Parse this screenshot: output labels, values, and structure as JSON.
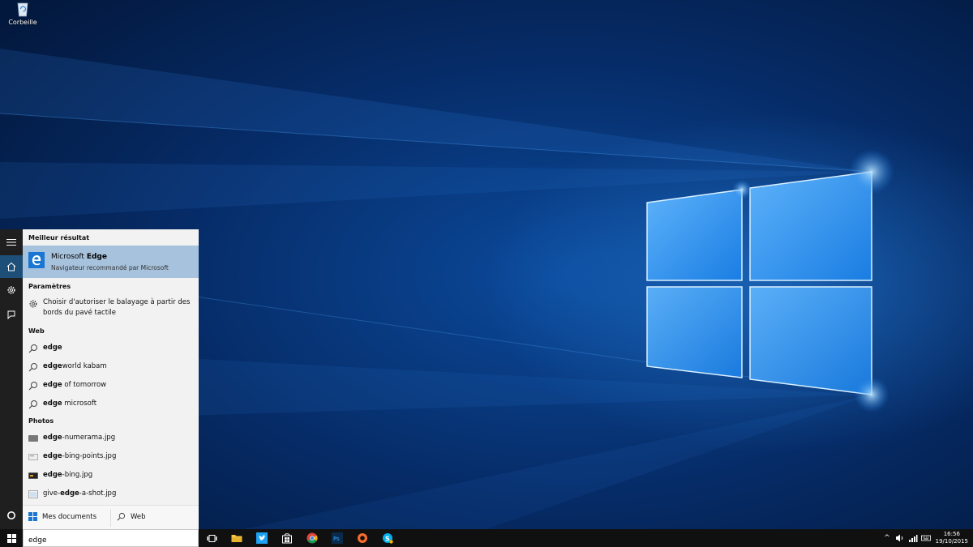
{
  "desktop": {
    "icons": [
      {
        "label": "Corbeille",
        "icon": "recycle-bin-icon"
      }
    ]
  },
  "start_rail": {
    "items": [
      {
        "name": "menu",
        "icon": "hamburger-icon"
      },
      {
        "name": "home",
        "icon": "home-icon",
        "active": true
      },
      {
        "name": "settings",
        "icon": "gear-icon"
      },
      {
        "name": "feedback",
        "icon": "feedback-icon"
      }
    ],
    "cortana_icon": "cortana-circle-icon"
  },
  "search_panel": {
    "best_match_header": "Meilleur résultat",
    "best_match": {
      "name_prefix": "Microsoft ",
      "name_bold": "Edge",
      "subtitle": "Navigateur recommandé par Microsoft",
      "icon": "edge-icon"
    },
    "settings_header": "Paramètres",
    "settings_items": [
      {
        "text": "Choisir d'autoriser le balayage à partir des bords du pavé tactile",
        "icon": "gear-icon"
      }
    ],
    "web_header": "Web",
    "web_items": [
      {
        "bold": "edge",
        "rest": ""
      },
      {
        "bold": "edge",
        "rest": "world kabam"
      },
      {
        "bold": "edge",
        "rest": " of tomorrow"
      },
      {
        "bold": "edge",
        "rest": " microsoft"
      }
    ],
    "photos_header": "Photos",
    "photo_items": [
      {
        "pre": "",
        "bold": "edge",
        "post": "-numerama.jpg"
      },
      {
        "pre": "",
        "bold": "edge",
        "post": "-bing-points.jpg"
      },
      {
        "pre": "",
        "bold": "edge",
        "post": "-bing.jpg"
      },
      {
        "pre": "give-",
        "bold": "edge",
        "post": "-a-shot.jpg"
      }
    ],
    "footer": {
      "documents_label": "Mes documents",
      "web_label": "Web"
    }
  },
  "taskbar": {
    "search_value": "edge",
    "pinned": [
      "task-view-icon",
      "file-explorer-icon",
      "twitter-icon",
      "store-icon",
      "chrome-icon",
      "photoshop-icon",
      "origin-icon",
      "skype-icon"
    ],
    "clock_time": "16:56",
    "clock_date": "19/10/2015",
    "colors": {
      "accent": "#1976d2",
      "taskbar": "#101010",
      "selection": "#a7c2dc"
    }
  }
}
